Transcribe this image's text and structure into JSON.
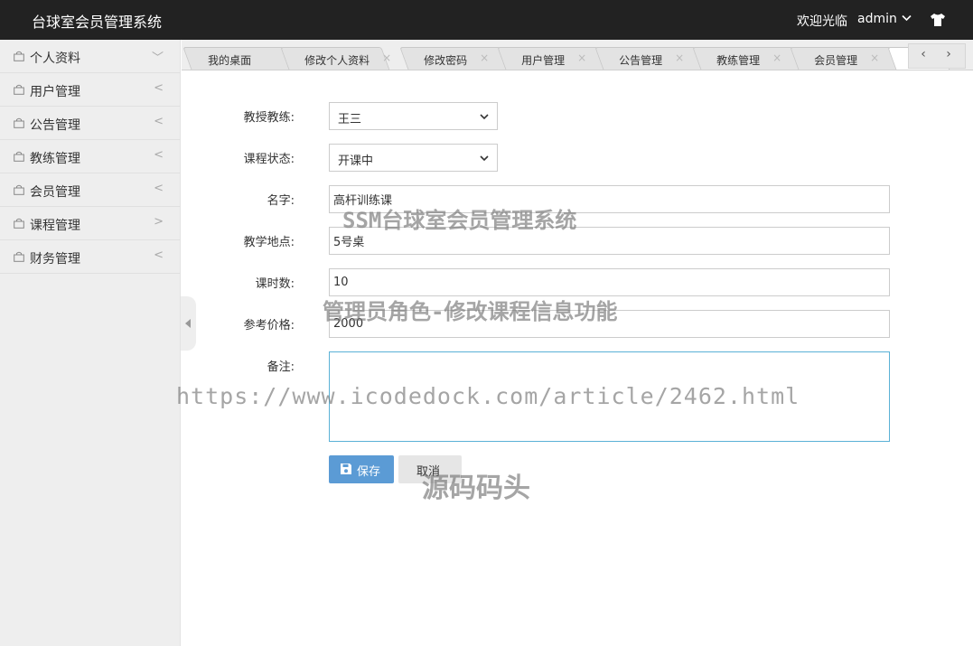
{
  "header": {
    "title": "台球室会员管理系统",
    "welcome": "欢迎光临",
    "username": "admin",
    "user_chevron_icon": "chevron-down-icon",
    "skin_icon": "tshirt-icon"
  },
  "sidebar": {
    "items": [
      {
        "label": "个人资料",
        "arrow": "﹀"
      },
      {
        "label": "用户管理",
        "arrow": "<"
      },
      {
        "label": "公告管理",
        "arrow": "<"
      },
      {
        "label": "教练管理",
        "arrow": "<"
      },
      {
        "label": "会员管理",
        "arrow": "<"
      },
      {
        "label": "课程管理",
        "arrow": ">"
      },
      {
        "label": "财务管理",
        "arrow": "<"
      }
    ]
  },
  "tabs": [
    {
      "label": "我的桌面",
      "closable": false
    },
    {
      "label": "修改个人资料",
      "closable": true
    },
    {
      "label": "修改密码",
      "closable": true
    },
    {
      "label": "用户管理",
      "closable": true
    },
    {
      "label": "公告管理",
      "closable": true
    },
    {
      "label": "教练管理",
      "closable": true
    },
    {
      "label": "会员管理",
      "closable": true
    }
  ],
  "tab_close_glyph": "×",
  "tab_nav": {
    "prev": "‹",
    "next": "›"
  },
  "form": {
    "coach_label": "教授教练:",
    "coach_value": "王三",
    "status_label": "课程状态:",
    "status_value": "开课中",
    "name_label": "名字:",
    "name_value": "高杆训练课",
    "location_label": "教学地点:",
    "location_value": "5号桌",
    "hours_label": "课时数:",
    "hours_value": "10",
    "price_label": "参考价格:",
    "price_value": "2000",
    "remark_label": "备注:",
    "remark_value": "",
    "save_label": "保存",
    "cancel_label": "取消",
    "select_caret": "⌄"
  },
  "watermarks": {
    "line1": "SSM台球室会员管理系统",
    "line2": "管理员角色-修改课程信息功能",
    "line3": "https://www.icodedock.com/article/2462.html",
    "line4": "源码码头"
  },
  "colors": {
    "header_bg": "#222222",
    "sidebar_bg": "#eeeeee",
    "save_button": "#5b9bd5",
    "textarea_border": "#5ab1d6"
  }
}
